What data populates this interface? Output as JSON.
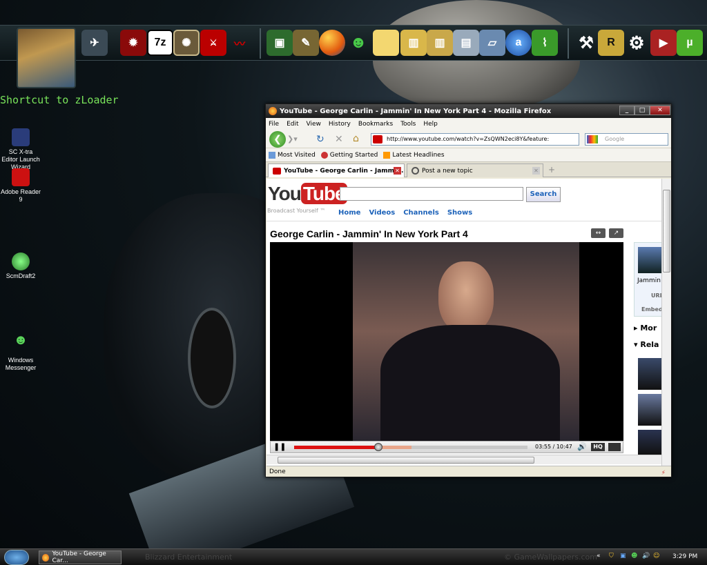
{
  "desktop": {
    "shortcut_label": "Shortcut to zLoader",
    "icons": [
      {
        "label": "SC X-tra Editor Launch Wizard"
      },
      {
        "label": "Adobe Reader 9"
      },
      {
        "label": "ScmDraft2"
      },
      {
        "label": "Windows Messenger"
      }
    ],
    "watermark_left": "Blizzard Entertainment",
    "watermark_right": "© GameWallpapers.com"
  },
  "dock": {
    "icons": [
      "battlecruiser-icon",
      "zerg-icon",
      "7zip-icon",
      "warcraft-icon",
      "winmpq-icon",
      "dragon-icon",
      "monitor-icon",
      "gimp-icon",
      "firefox-icon",
      "messenger-icon",
      "folder-icon",
      "archive-icon",
      "archive2-icon",
      "document-icon",
      "drive-icon",
      "aim-icon",
      "chart-icon",
      "hammer-icon",
      "r-icon",
      "settings-icon",
      "video-icon",
      "utorrent-icon"
    ],
    "labels": {
      "7zip": "7z",
      "r": "R",
      "utorrent": "µ"
    }
  },
  "firefox": {
    "title": "YouTube - George Carlin - Jammin' In New York Part 4 - Mozilla Firefox",
    "menu": [
      "File",
      "Edit",
      "View",
      "History",
      "Bookmarks",
      "Tools",
      "Help"
    ],
    "url": "http://www.youtube.com/watch?v=ZsQWN2eci8Y&feature:",
    "search_placeholder": "Google",
    "bookmarks": [
      "Most Visited",
      "Getting Started",
      "Latest Headlines"
    ],
    "tabs": [
      {
        "label": "YouTube - George Carlin - Jammi..."
      },
      {
        "label": "Post a new topic"
      }
    ],
    "status": "Done"
  },
  "youtube": {
    "logo_you": "You",
    "logo_tube": "Tube",
    "tagline": "Broadcast Yourself ™",
    "search_button": "Search",
    "nav": [
      "Home",
      "Videos",
      "Channels",
      "Shows"
    ],
    "video_title": "George Carlin - Jammin' In New York Part 4",
    "time": "03:55 / 10:47",
    "progress": 0.36,
    "hq_label": "HQ",
    "side": {
      "user": "Jammin",
      "url_label": "URL",
      "embed_label": "Embed",
      "more_label": "Mor",
      "related_label": "Rela"
    }
  },
  "taskbar": {
    "item": "YouTube - George Car...",
    "clock": "3:29 PM"
  }
}
